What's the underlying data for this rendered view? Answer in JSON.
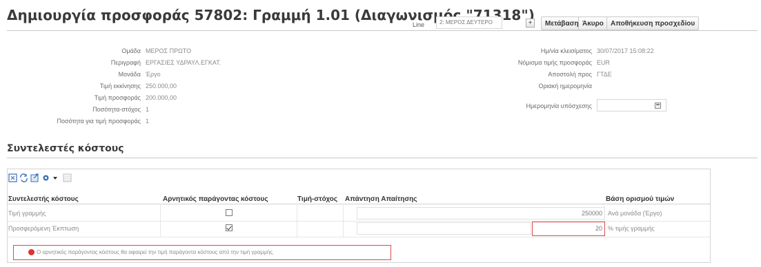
{
  "header": {
    "title": "Δημιουργία προσφοράς 57802: Γραμμή 1.01 (Διαγωνισμός \"71318\")",
    "line_label": "Line",
    "line_value": "2: ΜΕΡΟΣ ΔΕΥΤΕΡΟ",
    "buttons": {
      "go": "Μετάβαση",
      "cancel": "Άκυρο",
      "save_draft": "Αποθήκευση προσχεδίου"
    }
  },
  "left_fields": [
    {
      "label": "Ομάδα",
      "value": "ΜΕΡΟΣ ΠΡΩΤΟ"
    },
    {
      "label": "Περιγραφή",
      "value": "ΕΡΓΑΣΙΕΣ ΥΔΡΑΥΛ.ΕΓΚΑΤ."
    },
    {
      "label": "Μονάδα",
      "value": "Έργο"
    },
    {
      "label": "Τιμή εκκίνησης",
      "value": "250.000,00"
    },
    {
      "label": "Τιμή προσφοράς",
      "value": "200.000,00"
    },
    {
      "label": "Ποσότητα-στόχος",
      "value": "1"
    },
    {
      "label": "Ποσότητα για τιμή προσφοράς",
      "value": "1"
    }
  ],
  "right_fields": [
    {
      "label": "Ημ/νία κλεισίματος",
      "value": "30/07/2017 15:08:22"
    },
    {
      "label": "Νόμισμα τιμής προσφοράς",
      "value": "EUR"
    },
    {
      "label": "Αποστολή προς",
      "value": "ΓΤΔΕ"
    },
    {
      "label": "Οριακή ημερομηνία",
      "value": ""
    },
    {
      "label": "Ημερομηνία υπόσχεσης",
      "value": ""
    }
  ],
  "cost_factors": {
    "section_title": "Συντελεστές κόστους",
    "toolbar_icons": [
      "detach-icon",
      "refresh-icon",
      "export-icon",
      "settings-icon",
      "dropdown-icon",
      "columns-icon"
    ],
    "columns": {
      "factor": "Συντελεστής κόστους",
      "negative": "Αρνητικός παράγοντας κόστους",
      "target": "Τιμή-στόχος",
      "response": "Απάντηση Απαίτησης",
      "pricing_basis": "Βάση ορισμού τιμών"
    },
    "rows": [
      {
        "factor": "Τιμή γραμμής",
        "negative": false,
        "response": "250000",
        "basis": "Ανά μονάδα (Έργο)"
      },
      {
        "factor": "Προσφερόμενη Έκπτωση",
        "negative": true,
        "response": "20",
        "basis": "% τιμής γραμμής"
      }
    ],
    "error_message": "Ο αρνητικός παράγοντας κόστους θα αφαιρεί την τιμή παράγοντα κόστους από την τιμή γραμμής."
  },
  "colors": {
    "error": "#e04848",
    "title": "#3a3a3a"
  }
}
